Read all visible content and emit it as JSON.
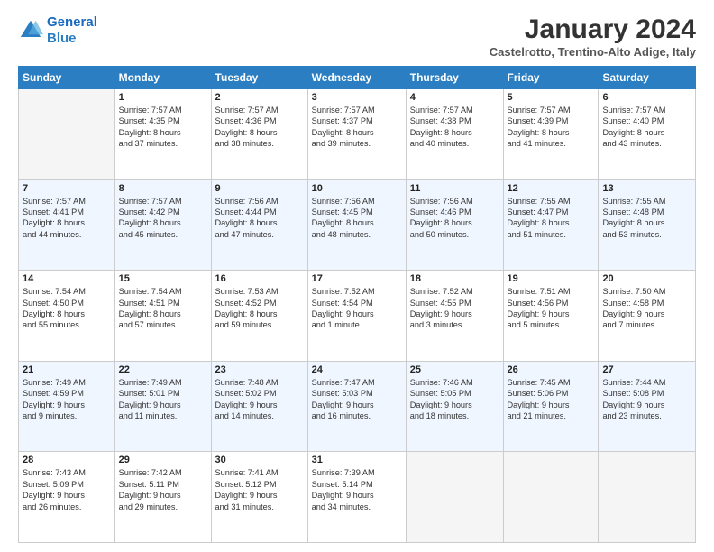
{
  "header": {
    "logo_line1": "General",
    "logo_line2": "Blue",
    "month_title": "January 2024",
    "location": "Castelrotto, Trentino-Alto Adige, Italy"
  },
  "weekdays": [
    "Sunday",
    "Monday",
    "Tuesday",
    "Wednesday",
    "Thursday",
    "Friday",
    "Saturday"
  ],
  "weeks": [
    [
      {
        "day": "",
        "info": ""
      },
      {
        "day": "1",
        "info": "Sunrise: 7:57 AM\nSunset: 4:35 PM\nDaylight: 8 hours\nand 37 minutes."
      },
      {
        "day": "2",
        "info": "Sunrise: 7:57 AM\nSunset: 4:36 PM\nDaylight: 8 hours\nand 38 minutes."
      },
      {
        "day": "3",
        "info": "Sunrise: 7:57 AM\nSunset: 4:37 PM\nDaylight: 8 hours\nand 39 minutes."
      },
      {
        "day": "4",
        "info": "Sunrise: 7:57 AM\nSunset: 4:38 PM\nDaylight: 8 hours\nand 40 minutes."
      },
      {
        "day": "5",
        "info": "Sunrise: 7:57 AM\nSunset: 4:39 PM\nDaylight: 8 hours\nand 41 minutes."
      },
      {
        "day": "6",
        "info": "Sunrise: 7:57 AM\nSunset: 4:40 PM\nDaylight: 8 hours\nand 43 minutes."
      }
    ],
    [
      {
        "day": "7",
        "info": "Sunrise: 7:57 AM\nSunset: 4:41 PM\nDaylight: 8 hours\nand 44 minutes."
      },
      {
        "day": "8",
        "info": "Sunrise: 7:57 AM\nSunset: 4:42 PM\nDaylight: 8 hours\nand 45 minutes."
      },
      {
        "day": "9",
        "info": "Sunrise: 7:56 AM\nSunset: 4:44 PM\nDaylight: 8 hours\nand 47 minutes."
      },
      {
        "day": "10",
        "info": "Sunrise: 7:56 AM\nSunset: 4:45 PM\nDaylight: 8 hours\nand 48 minutes."
      },
      {
        "day": "11",
        "info": "Sunrise: 7:56 AM\nSunset: 4:46 PM\nDaylight: 8 hours\nand 50 minutes."
      },
      {
        "day": "12",
        "info": "Sunrise: 7:55 AM\nSunset: 4:47 PM\nDaylight: 8 hours\nand 51 minutes."
      },
      {
        "day": "13",
        "info": "Sunrise: 7:55 AM\nSunset: 4:48 PM\nDaylight: 8 hours\nand 53 minutes."
      }
    ],
    [
      {
        "day": "14",
        "info": "Sunrise: 7:54 AM\nSunset: 4:50 PM\nDaylight: 8 hours\nand 55 minutes."
      },
      {
        "day": "15",
        "info": "Sunrise: 7:54 AM\nSunset: 4:51 PM\nDaylight: 8 hours\nand 57 minutes."
      },
      {
        "day": "16",
        "info": "Sunrise: 7:53 AM\nSunset: 4:52 PM\nDaylight: 8 hours\nand 59 minutes."
      },
      {
        "day": "17",
        "info": "Sunrise: 7:52 AM\nSunset: 4:54 PM\nDaylight: 9 hours\nand 1 minute."
      },
      {
        "day": "18",
        "info": "Sunrise: 7:52 AM\nSunset: 4:55 PM\nDaylight: 9 hours\nand 3 minutes."
      },
      {
        "day": "19",
        "info": "Sunrise: 7:51 AM\nSunset: 4:56 PM\nDaylight: 9 hours\nand 5 minutes."
      },
      {
        "day": "20",
        "info": "Sunrise: 7:50 AM\nSunset: 4:58 PM\nDaylight: 9 hours\nand 7 minutes."
      }
    ],
    [
      {
        "day": "21",
        "info": "Sunrise: 7:49 AM\nSunset: 4:59 PM\nDaylight: 9 hours\nand 9 minutes."
      },
      {
        "day": "22",
        "info": "Sunrise: 7:49 AM\nSunset: 5:01 PM\nDaylight: 9 hours\nand 11 minutes."
      },
      {
        "day": "23",
        "info": "Sunrise: 7:48 AM\nSunset: 5:02 PM\nDaylight: 9 hours\nand 14 minutes."
      },
      {
        "day": "24",
        "info": "Sunrise: 7:47 AM\nSunset: 5:03 PM\nDaylight: 9 hours\nand 16 minutes."
      },
      {
        "day": "25",
        "info": "Sunrise: 7:46 AM\nSunset: 5:05 PM\nDaylight: 9 hours\nand 18 minutes."
      },
      {
        "day": "26",
        "info": "Sunrise: 7:45 AM\nSunset: 5:06 PM\nDaylight: 9 hours\nand 21 minutes."
      },
      {
        "day": "27",
        "info": "Sunrise: 7:44 AM\nSunset: 5:08 PM\nDaylight: 9 hours\nand 23 minutes."
      }
    ],
    [
      {
        "day": "28",
        "info": "Sunrise: 7:43 AM\nSunset: 5:09 PM\nDaylight: 9 hours\nand 26 minutes."
      },
      {
        "day": "29",
        "info": "Sunrise: 7:42 AM\nSunset: 5:11 PM\nDaylight: 9 hours\nand 29 minutes."
      },
      {
        "day": "30",
        "info": "Sunrise: 7:41 AM\nSunset: 5:12 PM\nDaylight: 9 hours\nand 31 minutes."
      },
      {
        "day": "31",
        "info": "Sunrise: 7:39 AM\nSunset: 5:14 PM\nDaylight: 9 hours\nand 34 minutes."
      },
      {
        "day": "",
        "info": ""
      },
      {
        "day": "",
        "info": ""
      },
      {
        "day": "",
        "info": ""
      }
    ]
  ]
}
